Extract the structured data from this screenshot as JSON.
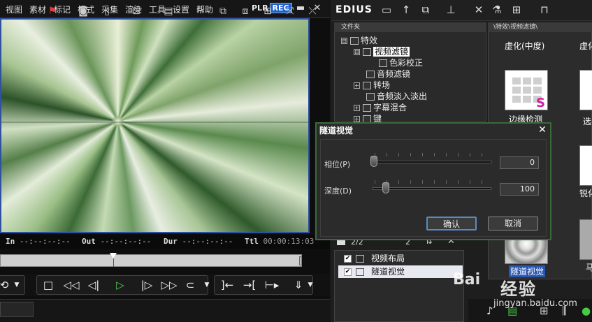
{
  "menu": [
    "视图",
    "素材",
    "标记",
    "模式",
    "采集",
    "渲染",
    "工具",
    "设置",
    "帮助"
  ],
  "plr": {
    "plr": "PLR",
    "rec": "REC"
  },
  "window_controls": {
    "minimize": "▬",
    "close": "✕"
  },
  "timecodes": {
    "in_label": "In",
    "in_value": "--:--:--:--",
    "out_label": "Out",
    "out_value": "--:--:--:--",
    "dur_label": "Dur",
    "dur_value": "--:--:--:--",
    "ttl_label": "Ttl",
    "ttl_value": "00:00:13:03"
  },
  "app": {
    "title": "EDIUS"
  },
  "folder_panel": {
    "header": "文件夹",
    "tree": [
      {
        "label": "特效",
        "level": 0,
        "expander": "⊟"
      },
      {
        "label": "视频滤镜",
        "level": 1,
        "expander": "⊟",
        "selected": true
      },
      {
        "label": "色彩校正",
        "level": 2,
        "expander": ""
      },
      {
        "label": "音频滤镜",
        "level": 1,
        "expander": ""
      },
      {
        "label": "转场",
        "level": 1,
        "expander": "+"
      },
      {
        "label": "音频淡入淡出",
        "level": 1,
        "expander": ""
      },
      {
        "label": "字幕混合",
        "level": 1,
        "expander": "+"
      },
      {
        "label": "键",
        "level": 1,
        "expander": "+"
      }
    ]
  },
  "effects_panel": {
    "header": "\\特效\\视频滤镜\\",
    "items": [
      "虚化(中度)",
      "虚化",
      "边缘检测",
      "选",
      "锐化",
      "马",
      "隧道视觉"
    ]
  },
  "bottom_list": {
    "count": "2/2",
    "count2": "2",
    "rows": [
      {
        "label": "视频布局",
        "checked": true,
        "selected": false
      },
      {
        "label": "隧道视觉",
        "checked": true,
        "selected": true
      }
    ]
  },
  "dialog": {
    "title": "隧道视觉",
    "close": "✕",
    "phase_label": "相位(P)",
    "phase_value": "0",
    "phase_fraction": 0.0,
    "depth_label": "深度(D)",
    "depth_value": "100",
    "depth_fraction": 0.1,
    "ok_label": "确认",
    "cancel_label": "取消"
  },
  "watermark": {
    "paw": "Bai",
    "brand": "经验",
    "url": "jingyan.baidu.com"
  }
}
